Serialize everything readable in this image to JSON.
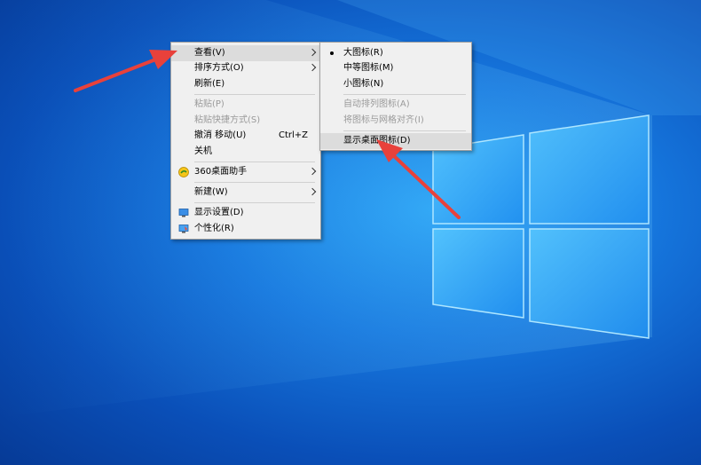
{
  "context_menu": {
    "items": [
      {
        "label": "查看(V)",
        "submenu": true
      },
      {
        "label": "排序方式(O)",
        "submenu": true
      },
      {
        "label": "刷新(E)"
      },
      {
        "label": "粘贴(P)",
        "disabled": true
      },
      {
        "label": "粘贴快捷方式(S)",
        "disabled": true
      },
      {
        "label": "撤消 移动(U)",
        "shortcut": "Ctrl+Z"
      },
      {
        "label": "关机"
      },
      {
        "label": "360桌面助手",
        "submenu": true,
        "icon": "360-icon"
      },
      {
        "label": "新建(W)",
        "submenu": true
      },
      {
        "label": "显示设置(D)",
        "icon": "display-settings-icon"
      },
      {
        "label": "个性化(R)",
        "icon": "personalize-icon"
      }
    ]
  },
  "view_submenu": {
    "items": [
      {
        "label": "大图标(R)",
        "selected": true
      },
      {
        "label": "中等图标(M)"
      },
      {
        "label": "小图标(N)"
      },
      {
        "label": "自动排列图标(A)",
        "disabled": true
      },
      {
        "label": "将图标与网格对齐(I)",
        "disabled": true
      },
      {
        "label": "显示桌面图标(D)"
      }
    ]
  },
  "colors": {
    "annotation_arrow": "#e8413b",
    "accent": "#1677de"
  }
}
